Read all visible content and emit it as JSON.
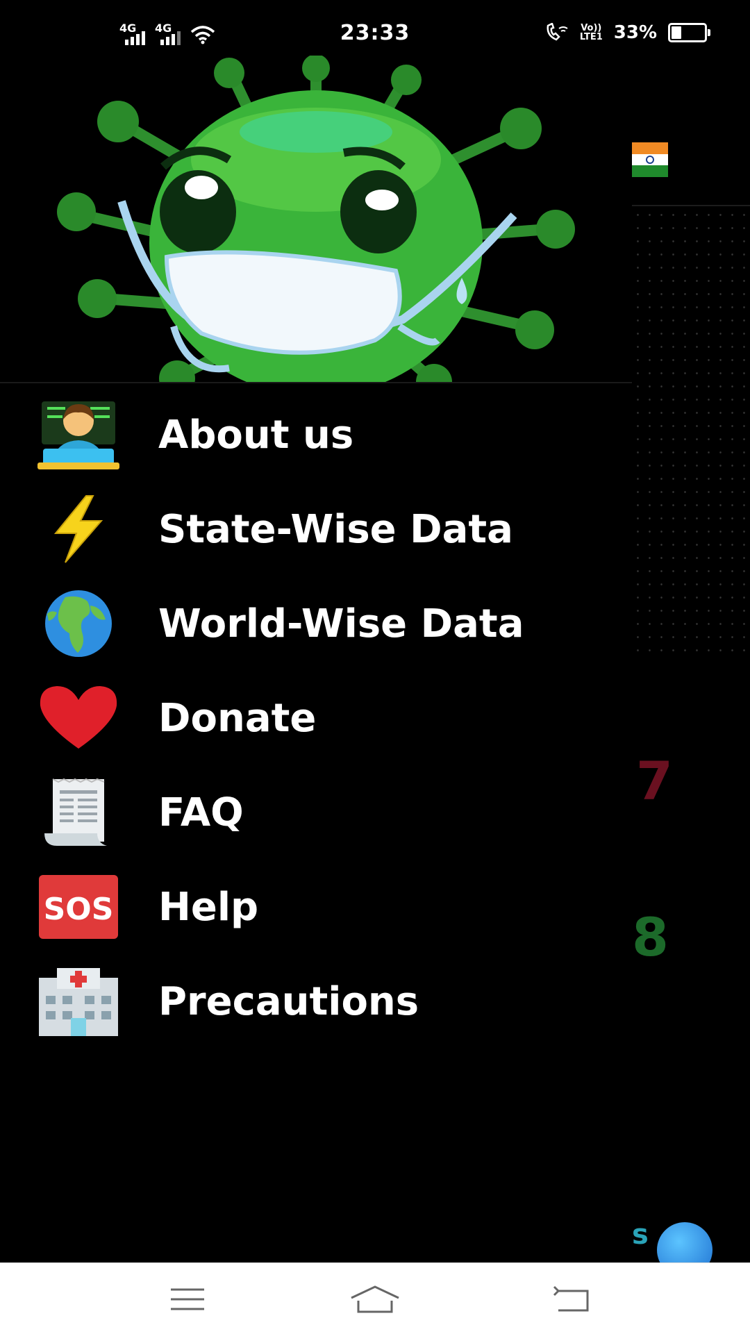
{
  "status_bar": {
    "net1": "4G",
    "net2": "4G",
    "time": "23:33",
    "volte_line1": "Vo))",
    "volte_line2": "LTE1",
    "battery": "33%"
  },
  "drawer": {
    "header_image": "masked-virus-illustration",
    "items": [
      {
        "label": "About us",
        "icon": "technologist-emoji"
      },
      {
        "label": "State-Wise Data",
        "icon": "lightning-emoji"
      },
      {
        "label": "World-Wise Data",
        "icon": "globe-emoji"
      },
      {
        "label": "Donate",
        "icon": "red-heart-emoji"
      },
      {
        "label": "FAQ",
        "icon": "receipt-scroll-emoji"
      },
      {
        "label": "Help",
        "icon": "sos-emoji"
      },
      {
        "label": "Precautions",
        "icon": "hospital-emoji"
      }
    ]
  },
  "background_app": {
    "number1": "7",
    "number2": "8",
    "fragment": "s"
  },
  "colors": {
    "virus_green": "#3ab43a",
    "mask_blue": "#a9d4ef",
    "nav_bg": "#ffffff"
  }
}
